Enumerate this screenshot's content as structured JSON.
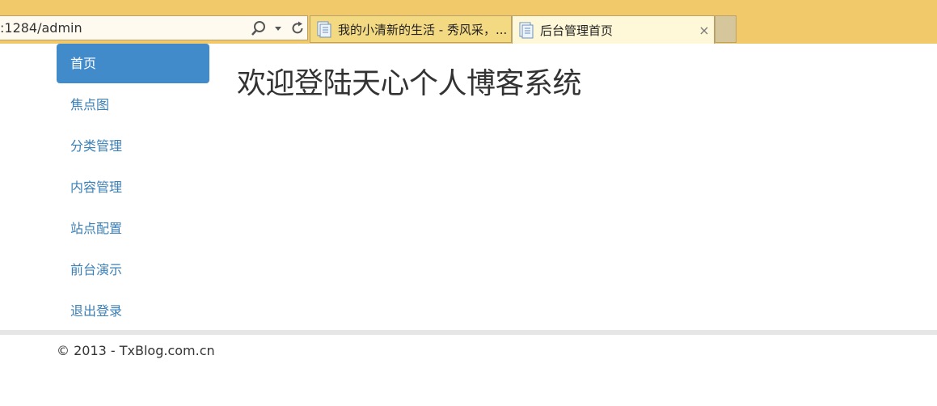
{
  "browser": {
    "address": ":1284/admin",
    "tabs": [
      {
        "label": "我的小清新的生活 - 秀风采，..."
      },
      {
        "label": "后台管理首页",
        "close": "×"
      }
    ]
  },
  "sidebar": {
    "items": [
      {
        "label": "首页"
      },
      {
        "label": "焦点图"
      },
      {
        "label": "分类管理"
      },
      {
        "label": "内容管理"
      },
      {
        "label": "站点配置"
      },
      {
        "label": "前台演示"
      },
      {
        "label": "退出登录"
      }
    ]
  },
  "main": {
    "heading": "欢迎登陆天心个人博客系统"
  },
  "footer": {
    "text": "© 2013 - TxBlog.com.cn"
  },
  "colors": {
    "chrome": "#f2c96a",
    "nav_active": "#428bca",
    "nav_link": "#3b7fb5"
  }
}
